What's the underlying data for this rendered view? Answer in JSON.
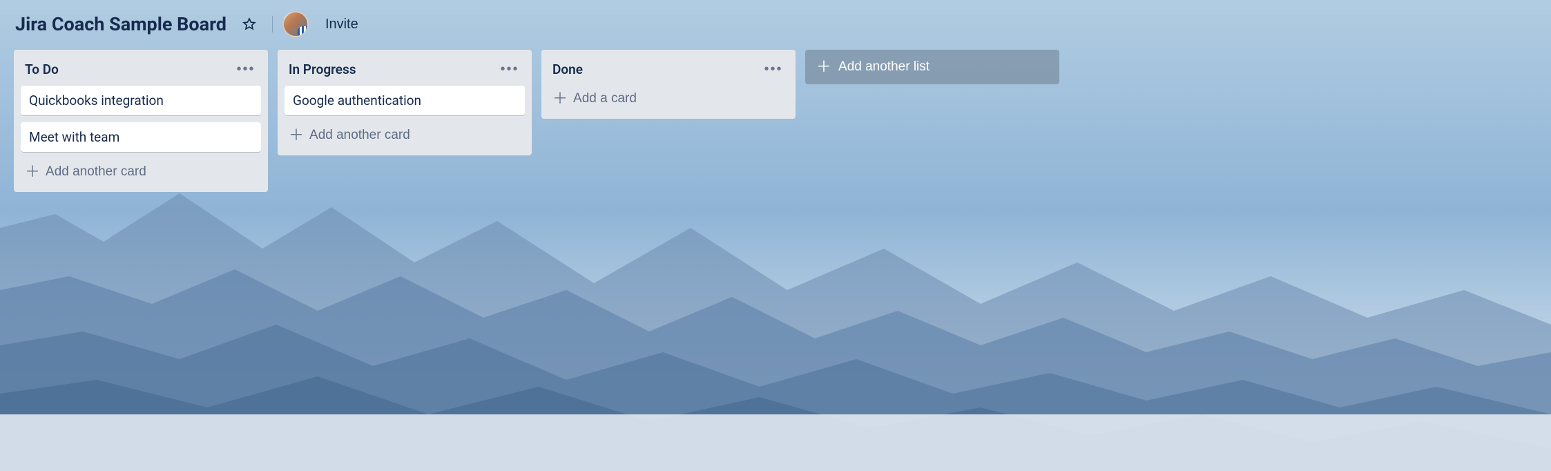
{
  "board": {
    "title": "Jira Coach Sample Board",
    "invite_label": "Invite"
  },
  "lists": [
    {
      "title": "To Do",
      "cards": [
        "Quickbooks integration",
        "Meet with team"
      ],
      "add_label": "Add another card"
    },
    {
      "title": "In Progress",
      "cards": [
        "Google authentication"
      ],
      "add_label": "Add another card"
    },
    {
      "title": "Done",
      "cards": [],
      "add_label": "Add a card"
    }
  ],
  "add_list_label": "Add another list"
}
